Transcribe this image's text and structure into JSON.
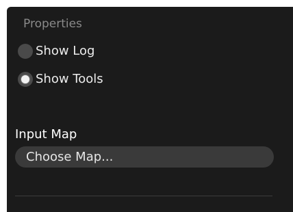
{
  "properties_panel": {
    "title": "Properties",
    "options": [
      {
        "label": "Show Log",
        "checked": false
      },
      {
        "label": "Show Tools",
        "checked": true
      }
    ],
    "input_map": {
      "label": "Input Map",
      "button_label": "Choose Map..."
    }
  },
  "colors": {
    "panel_background": "#1b1b1b",
    "radio_off": "#4a4a4a",
    "radio_on_dot": "#f2f2f2",
    "button_background": "#3a3a3a",
    "muted_text": "#8a8a8a"
  },
  "icons": {
    "unchecked_radio": "radio-unchecked-icon",
    "checked_radio": "radio-checked-icon"
  }
}
